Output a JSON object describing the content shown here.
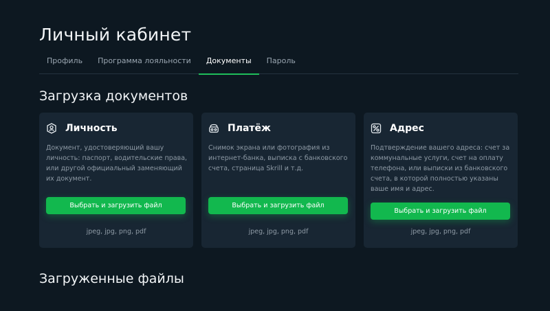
{
  "page": {
    "title": "Личный кабинет"
  },
  "tabs": [
    {
      "label": "Профиль",
      "active": false
    },
    {
      "label": "Программа лояльности",
      "active": false
    },
    {
      "label": "Документы",
      "active": true
    },
    {
      "label": "Пароль",
      "active": false
    }
  ],
  "upload_section": {
    "title": "Загрузка документов"
  },
  "cards": [
    {
      "icon": "person-badge-icon",
      "title": "Личность",
      "description": "Документ, удостоверяющий вашу личность: паспорт, водительские права, или другой официальный заменяющий их документ.",
      "button_label": "Выбрать и загрузить файл",
      "formats": "jpeg, jpg, png, pdf"
    },
    {
      "icon": "wallet-icon",
      "title": "Платёж",
      "description": "Снимок экрана или фотография из интернет-банка, выписка с банковского счета, страница Skrill и т.д.",
      "button_label": "Выбрать и загрузить файл",
      "formats": "jpeg, jpg, png, pdf"
    },
    {
      "icon": "address-card-icon",
      "title": "Адрес",
      "description": "Подтверждение вашего адреса: счет за коммунальные услуги, счет на оплату телефона, или выписки из банковского счета, в которой полностью указаны ваше имя и адрес.",
      "button_label": "Выбрать и загрузить файл",
      "formats": "jpeg, jpg, png, pdf"
    }
  ],
  "uploaded_section": {
    "title": "Загруженные файлы"
  },
  "colors": {
    "background": "#0d1821",
    "card": "#182633",
    "accent": "#12b84e",
    "muted_text": "#8e9aa5"
  }
}
